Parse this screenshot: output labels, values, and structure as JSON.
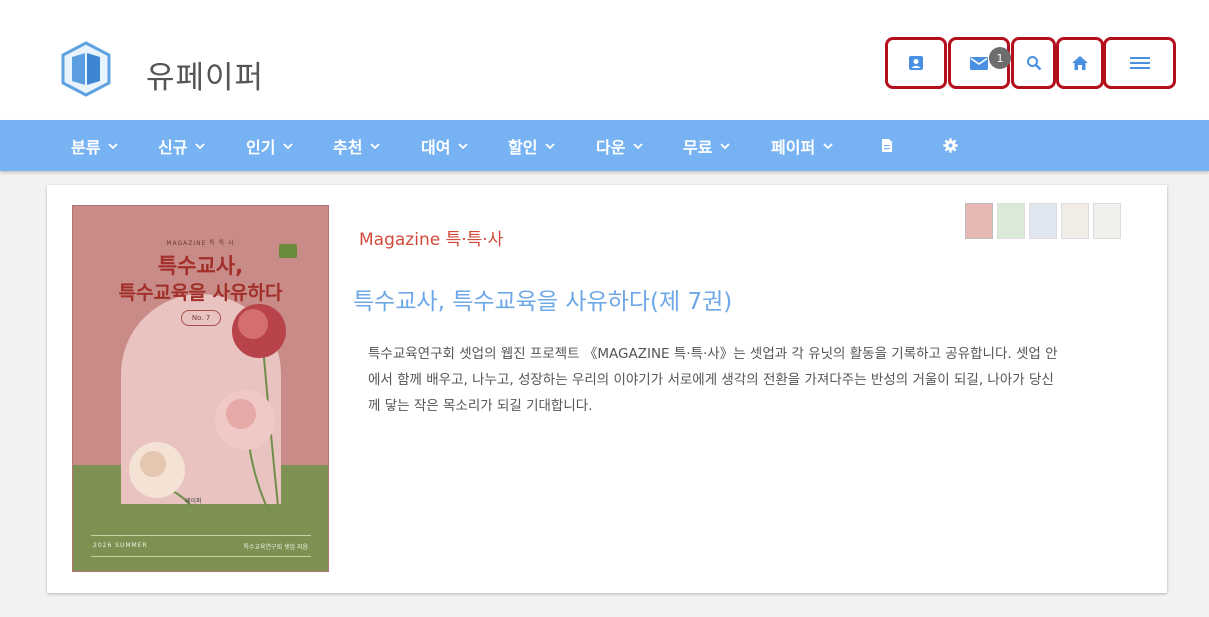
{
  "header": {
    "brand": "유페이퍼",
    "notification_count": "1",
    "buttons": [
      "profile",
      "mail",
      "search",
      "home",
      "menu"
    ]
  },
  "nav": {
    "items": [
      "분류",
      "신규",
      "인기",
      "추천",
      "대여",
      "할인",
      "다운",
      "무료",
      "페이퍼"
    ]
  },
  "book": {
    "category": "Magazine 특·특·사",
    "title": "특수교사, 특수교육을 사유하다(제 7권)",
    "description": "특수교육연구회 셋업의 웹진 프로젝트 《MAGAZINE 특·특·사》는 셋업과 각 유닛의 활동을 기록하고 공유합니다. 셋업 안에서 함께 배우고, 나누고, 성장하는 우리의 이야기가 서로에게 생각의 전환을 가져다주는 반성의 거울이 되길, 나아가 당신께 닿는 작은 목소리가 되길 기대합니다.",
    "cover": {
      "tag": "MAGAZINE 특 특 사",
      "title_line1": "특수교사,",
      "title_line2": "특수교육을 사유하다",
      "issue": "No. 7",
      "publisher": "페이퍼",
      "season": "2026 SUMMER",
      "author": "특수교육연구회 셋업 지음"
    },
    "thumbnail_colors": [
      "#e7b7b3",
      "#d9ead6",
      "#dfe6ef",
      "#f1ede6",
      "#f2f0ec"
    ]
  },
  "colors": {
    "nav_bg": "#77b3f2",
    "accent_red": "#b3101c",
    "title_blue": "#6fa8e6",
    "category_red": "#d14a3b"
  }
}
